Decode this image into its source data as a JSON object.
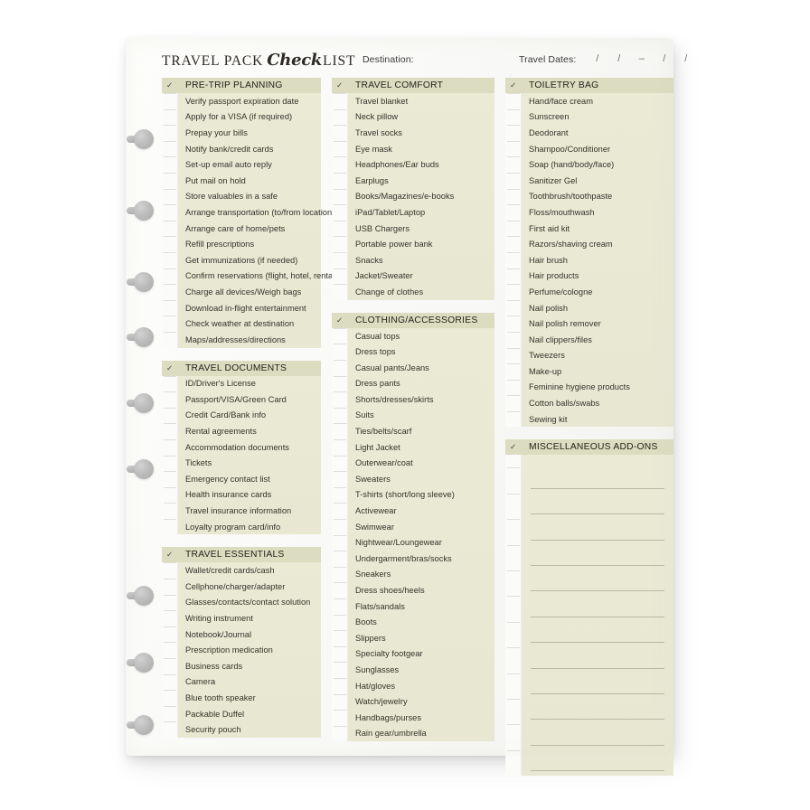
{
  "document": {
    "logo_part1": "TRAVEL PACK",
    "logo_script": "Check",
    "logo_part2": "LIST",
    "destination_label": "Destination:",
    "dates_label": "Travel Dates:",
    "date_slots": [
      "/",
      "/",
      "–",
      "/",
      "/"
    ],
    "check_glyph": "✓",
    "colors": {
      "paper": "#fdfdfb",
      "block_body": "#e9e9d4",
      "block_header": "#dcdcc0",
      "gutter": "#fbfbfa",
      "text": "#33332b",
      "rule": "#b9b9a2",
      "disc": "#bdbdbd"
    }
  },
  "columns": [
    {
      "name": "column-left",
      "blocks": [
        {
          "title": "PRE-TRIP PLANNING",
          "items": [
            "Verify passport expiration date",
            "Apply for a VISA (if required)",
            "Prepay your bills",
            "Notify bank/credit cards",
            "Set-up email auto reply",
            "Put mail on hold",
            "Store valuables in a safe",
            "Arrange transportation (to/from location)",
            "Arrange care of home/pets",
            "Refill prescriptions",
            "Get immunizations (if needed)",
            "Confirm reservations (flight, hotel, rental)",
            "Charge all devices/Weigh bags",
            "Download in-flight entertainment",
            "Check weather at destination",
            "Maps/addresses/directions"
          ]
        },
        {
          "title": "TRAVEL DOCUMENTS",
          "items": [
            "ID/Driver's License",
            "Passport/VISA/Green Card",
            "Credit Card/Bank info",
            "Rental agreements",
            "Accommodation documents",
            "Tickets",
            "Emergency contact list",
            "Health insurance cards",
            "Travel insurance information",
            "Loyalty program card/info"
          ]
        },
        {
          "title": "TRAVEL ESSENTIALS",
          "items": [
            "Wallet/credit cards/cash",
            "Cellphone/charger/adapter",
            "Glasses/contacts/contact solution",
            "Writing instrument",
            "Notebook/Journal",
            "Prescription medication",
            "Business cards",
            "Camera",
            "Blue tooth speaker",
            "Packable Duffel",
            "Security pouch"
          ]
        }
      ]
    },
    {
      "name": "column-middle",
      "blocks": [
        {
          "title": "TRAVEL COMFORT",
          "items": [
            "Travel blanket",
            "Neck pillow",
            "Travel socks",
            "Eye mask",
            "Headphones/Ear buds",
            "Earplugs",
            "Books/Magazines/e-books",
            "iPad/Tablet/Laptop",
            "USB Chargers",
            "Portable power bank",
            "Snacks",
            "Jacket/Sweater",
            "Change of clothes"
          ]
        },
        {
          "title": "CLOTHING/ACCESSORIES",
          "items": [
            "Casual tops",
            "Dress tops",
            "Casual pants/Jeans",
            "Dress pants",
            "Shorts/dresses/skirts",
            "Suits",
            "Ties/belts/scarf",
            "Light Jacket",
            "Outerwear/coat",
            "Sweaters",
            "T-shirts (short/long sleeve)",
            "Activewear",
            "Swimwear",
            "Nightwear/Loungewear",
            "Undergarment/bras/socks",
            "Sneakers",
            "Dress shoes/heels",
            "Flats/sandals",
            "Boots",
            "Slippers",
            "Specialty footgear",
            "Sunglasses",
            "Hat/gloves",
            "Watch/jewelry",
            "Handbags/purses",
            "Rain gear/umbrella"
          ]
        }
      ]
    },
    {
      "name": "column-right",
      "blocks": [
        {
          "title": "TOILETRY BAG",
          "items": [
            "Hand/face cream",
            "Sunscreen",
            "Deodorant",
            "Shampoo/Conditioner",
            "Soap (hand/body/face)",
            "Sanitizer Gel",
            "Toothbrush/toothpaste",
            "Floss/mouthwash",
            "First aid kit",
            "Razors/shaving cream",
            "Hair brush",
            "Hair products",
            "Perfume/cologne",
            "Nail polish",
            "Nail polish remover",
            "Nail clippers/files",
            "Tweezers",
            "Make-up",
            "Feminine hygiene products",
            "Cotton balls/swabs",
            "Sewing kit"
          ]
        },
        {
          "title": "MISCELLANEOUS ADD-ONS",
          "items": [],
          "blank_lines": 12
        }
      ]
    }
  ]
}
